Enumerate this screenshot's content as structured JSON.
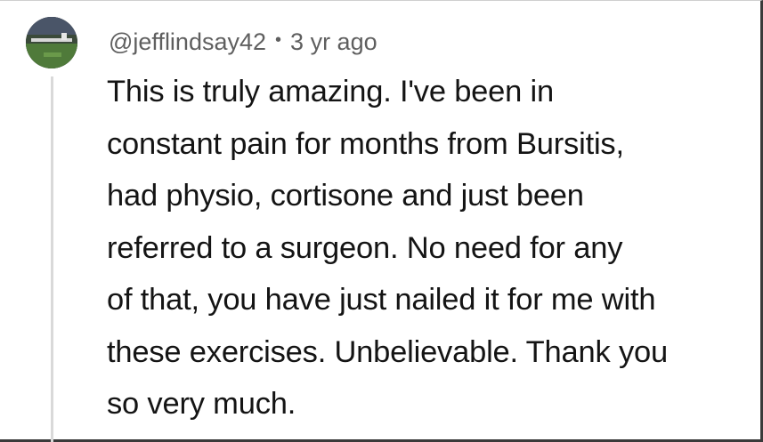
{
  "comment": {
    "author": "@jefflindsay42",
    "separator": "•",
    "timestamp": "3 yr ago",
    "text": "This is truly amazing. I've been in\nconstant pain for months from Bursitis,\nhad physio, cortisone and just been\nreferred to a surgeon.  No need for any\nof that, you have just nailed it for me with\nthese exercises. Unbelievable. Thank you\nso very much."
  }
}
